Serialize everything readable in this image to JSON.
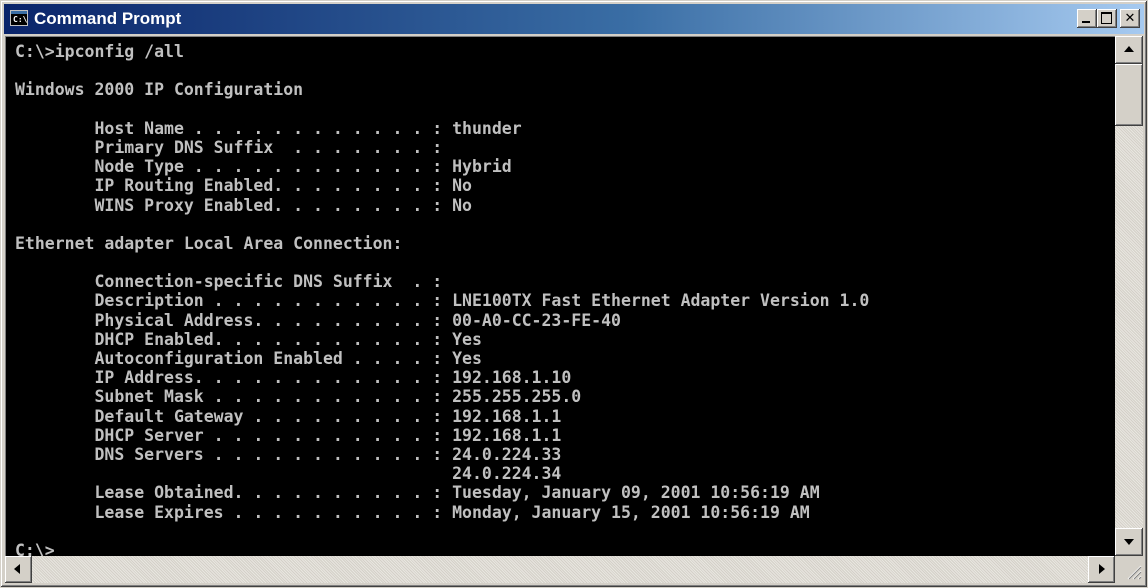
{
  "window": {
    "title": "Command Prompt",
    "icon": "command-prompt-icon",
    "controls": {
      "minimize_icon": "minimize-icon",
      "maximize_icon": "maximize-icon",
      "close_label": "✕"
    }
  },
  "console": {
    "background": "#000000",
    "foreground": "#c0c0c0",
    "lines": [
      "C:\\>ipconfig /all",
      "",
      "Windows 2000 IP Configuration",
      "",
      "        Host Name . . . . . . . . . . . . : thunder",
      "        Primary DNS Suffix  . . . . . . . :",
      "        Node Type . . . . . . . . . . . . : Hybrid",
      "        IP Routing Enabled. . . . . . . . : No",
      "        WINS Proxy Enabled. . . . . . . . : No",
      "",
      "Ethernet adapter Local Area Connection:",
      "",
      "        Connection-specific DNS Suffix  . :",
      "        Description . . . . . . . . . . . : LNE100TX Fast Ethernet Adapter Version 1.0",
      "        Physical Address. . . . . . . . . : 00-A0-CC-23-FE-40",
      "        DHCP Enabled. . . . . . . . . . . : Yes",
      "        Autoconfiguration Enabled . . . . : Yes",
      "        IP Address. . . . . . . . . . . . : 192.168.1.10",
      "        Subnet Mask . . . . . . . . . . . : 255.255.255.0",
      "        Default Gateway . . . . . . . . . : 192.168.1.1",
      "        DHCP Server . . . . . . . . . . . : 192.168.1.1",
      "        DNS Servers . . . . . . . . . . . : 24.0.224.33",
      "                                            24.0.224.34",
      "        Lease Obtained. . . . . . . . . . : Tuesday, January 09, 2001 10:56:19 AM",
      "        Lease Expires . . . . . . . . . . : Monday, January 15, 2001 10:56:19 AM",
      "",
      "C:\\>"
    ]
  },
  "scrollbars": {
    "vertical": {
      "up_icon": "scroll-up-arrow-icon",
      "down_icon": "scroll-down-arrow-icon"
    },
    "horizontal": {
      "left_icon": "scroll-left-arrow-icon",
      "right_icon": "scroll-right-arrow-icon"
    }
  }
}
